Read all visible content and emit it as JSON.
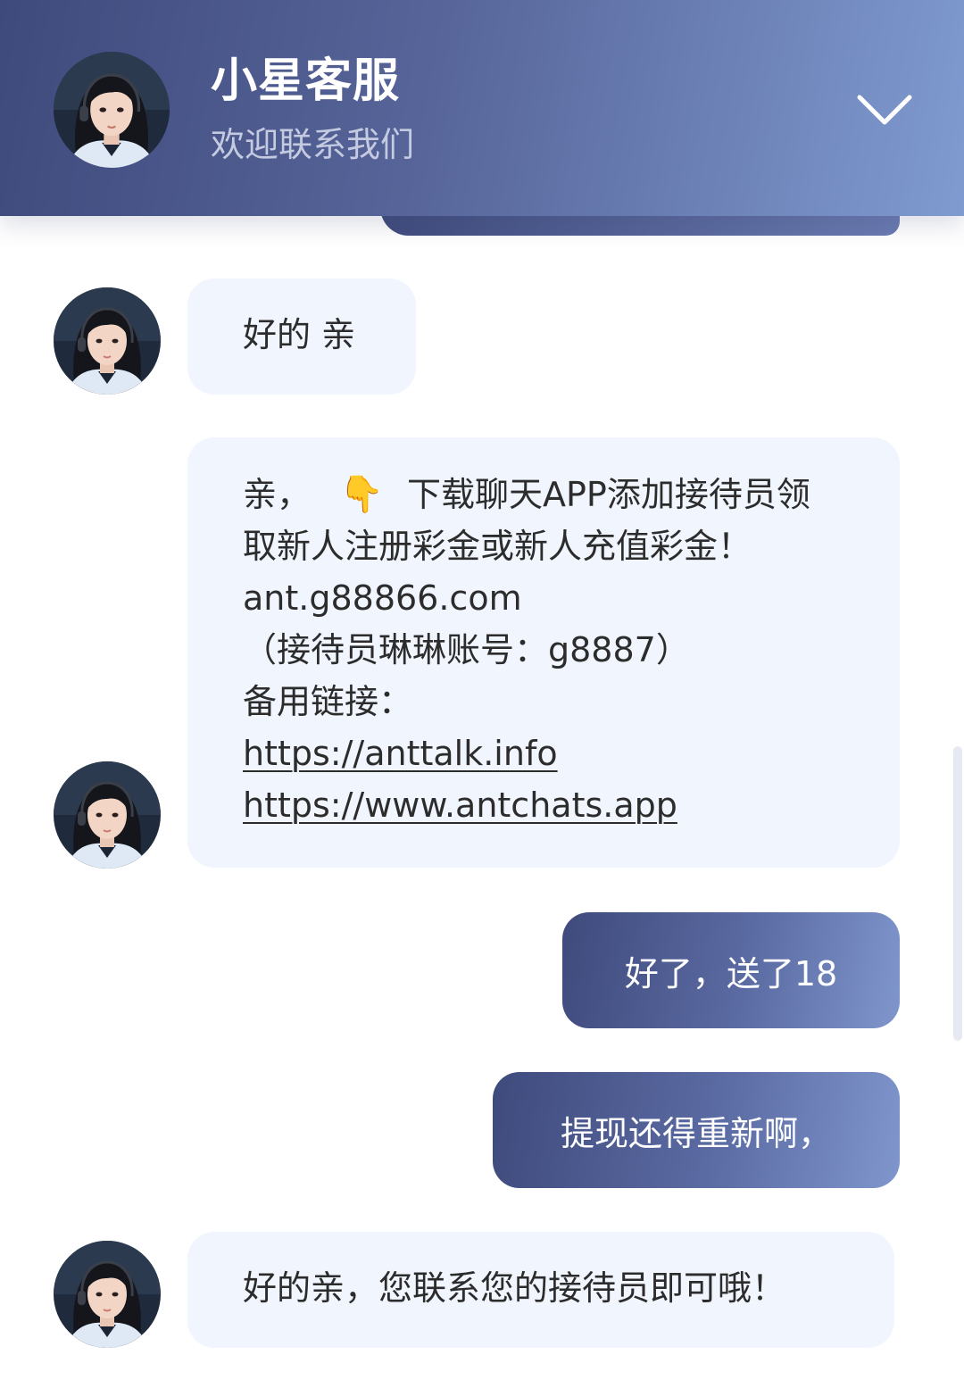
{
  "header": {
    "title": "小星客服",
    "subtitle": "欢迎联系我们",
    "collapse_icon": "chevron-down-icon"
  },
  "messages": [
    {
      "side": "agent",
      "lines": [
        "好的 亲"
      ]
    },
    {
      "side": "agent",
      "lines": [
        "亲，",
        "下载聊天APP添加接待员领",
        "取新人注册彩金或新人充值彩金！",
        "ant.g88866.com",
        "（接待员琳琳账号：g8887）",
        "备用链接："
      ],
      "emoji": "👇",
      "links": [
        "https://anttalk.info",
        "https://www.antchats.app"
      ]
    },
    {
      "side": "user",
      "text": "好了，送了18"
    },
    {
      "side": "user",
      "text": "提现还得重新啊，"
    },
    {
      "side": "agent",
      "lines": [
        "好的亲，您联系您的接待员即可哦！"
      ]
    }
  ],
  "colors": {
    "header_start": "#3f4a7c",
    "header_end": "#7f9bd0",
    "agent_bubble": "#f1f5fe",
    "user_bubble_start": "#3f4a7c",
    "user_bubble_end": "#7f96cc"
  }
}
